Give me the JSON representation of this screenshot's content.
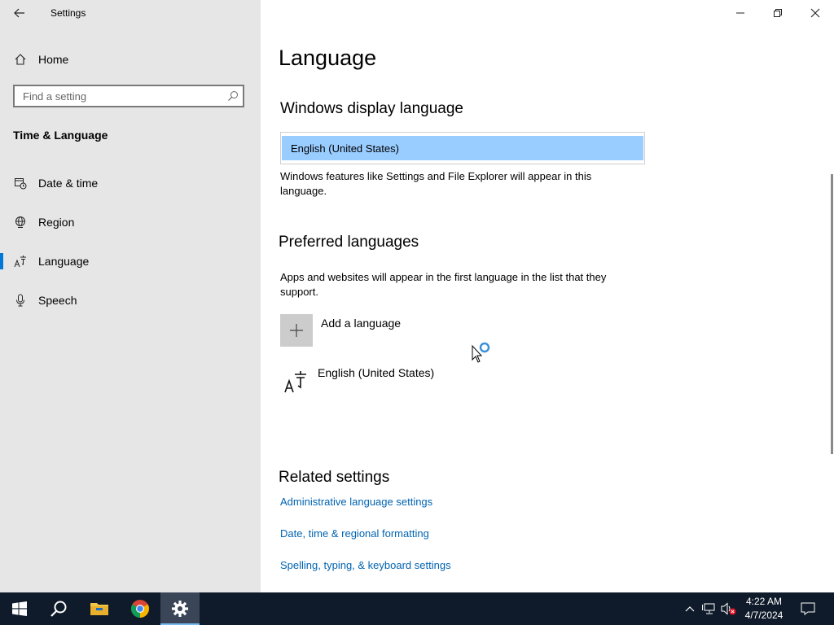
{
  "window": {
    "app_title": "Settings"
  },
  "sidebar": {
    "home_label": "Home",
    "search_placeholder": "Find a setting",
    "section_heading": "Time & Language",
    "items": [
      {
        "label": "Date & time",
        "icon": "calendar-clock-icon",
        "selected": false
      },
      {
        "label": "Region",
        "icon": "globe-icon",
        "selected": false
      },
      {
        "label": "Language",
        "icon": "language-icon",
        "selected": true
      },
      {
        "label": "Speech",
        "icon": "microphone-icon",
        "selected": false
      }
    ]
  },
  "main": {
    "page_title": "Language",
    "display_language": {
      "heading": "Windows display language",
      "selected_value": "English (United States)",
      "description": "Windows features like Settings and File Explorer will appear in this language."
    },
    "preferred": {
      "heading": "Preferred languages",
      "description": "Apps and websites will appear in the first language in the list that they support.",
      "add_label": "Add a language",
      "languages": [
        "English (United States)"
      ]
    },
    "related": {
      "heading": "Related settings",
      "links": [
        "Administrative language settings",
        "Date, time & regional formatting",
        "Spelling, typing, & keyboard settings"
      ]
    }
  },
  "taskbar": {
    "time": "4:22 AM",
    "date": "4/7/2024",
    "accent_color": "#0078d7"
  }
}
